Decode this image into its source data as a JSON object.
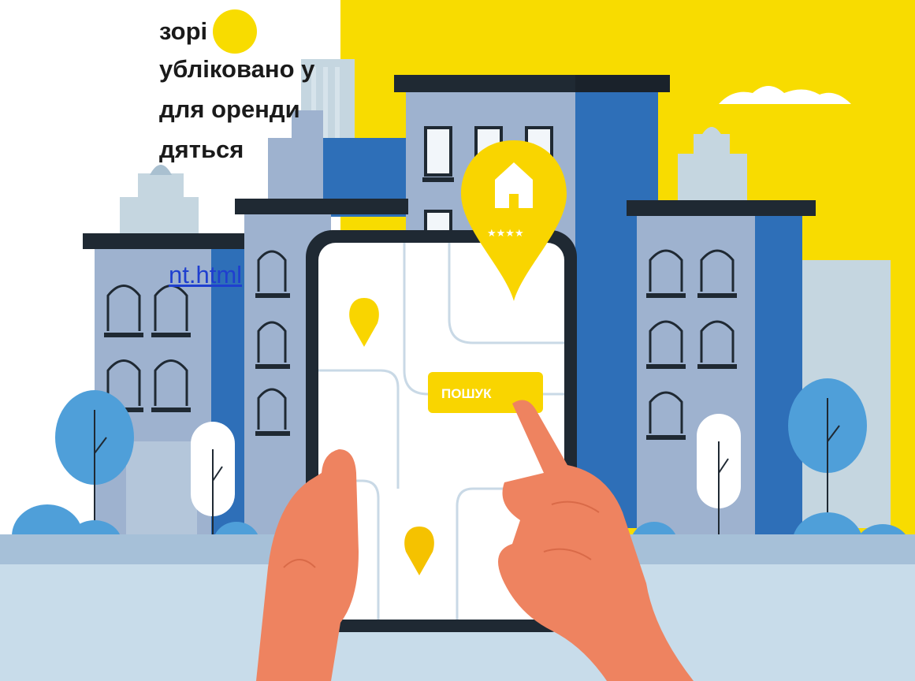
{
  "text": {
    "line1": "зорі",
    "line2": "ублiковано у",
    "line3": "для оренди",
    "line4": "дяться",
    "link": "nt.html"
  },
  "illustration": {
    "search_button_label": "ПОШУК",
    "pin_rating": "★★★★"
  },
  "colors": {
    "yellow": "#f8dc00",
    "pin_yellow": "#f9d500",
    "building_light": "#9eb2cf",
    "building_blue": "#2e6fb8",
    "building_pale": "#c5d6e0",
    "dark": "#1f2933",
    "skin": "#ee8360",
    "ground": "#c8dcea"
  }
}
